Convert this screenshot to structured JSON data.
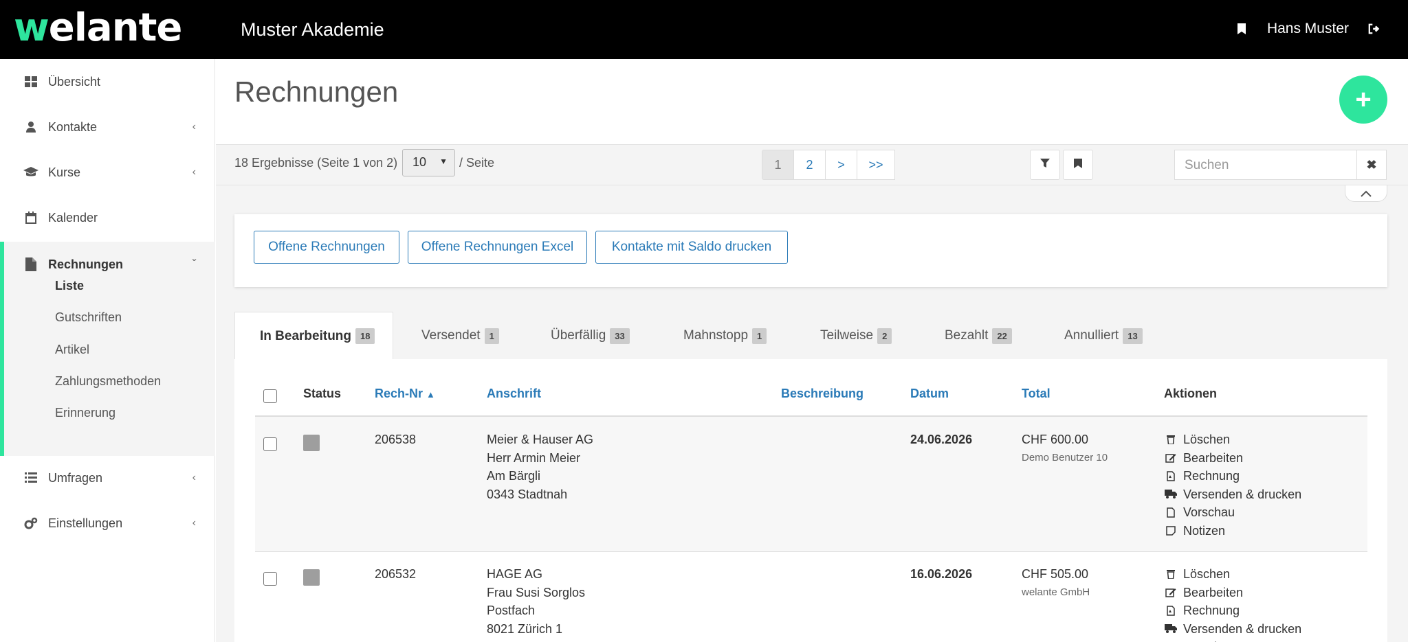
{
  "app": {
    "logo_w": "w",
    "logo_rest": "elante",
    "org_name": "Muster Akademie",
    "user_name": "Hans Muster",
    "brand_color": "#2ee59d"
  },
  "sidebar": {
    "items": [
      {
        "label": "Übersicht",
        "icon": "dashboard-icon"
      },
      {
        "label": "Kontakte",
        "icon": "user-icon"
      },
      {
        "label": "Kurse",
        "icon": "graduation-cap-icon"
      },
      {
        "label": "Kalender",
        "icon": "calendar-icon"
      },
      {
        "label": "Rechnungen",
        "icon": "file-icon"
      },
      {
        "label": "Umfragen",
        "icon": "list-icon"
      },
      {
        "label": "Einstellungen",
        "icon": "gears-icon"
      }
    ],
    "sub_items": [
      "Liste",
      "Gutschriften",
      "Artikel",
      "Zahlungsmethoden",
      "Erinnerung"
    ]
  },
  "page": {
    "title": "Rechnungen",
    "add_label": "+"
  },
  "toolbar": {
    "results_text": "18 Ergebnisse (Seite 1 von 2)",
    "per_page_value": "10",
    "per_page_label": "/ Seite",
    "pages": [
      "1",
      "2",
      ">",
      ">>"
    ],
    "search_placeholder": "Suchen",
    "clear_label": "✖"
  },
  "quick_actions": [
    "Offene Rechnungen",
    "Offene Rechnungen Excel",
    "Kontakte mit Saldo drucken"
  ],
  "tabs": [
    {
      "label": "In Bearbeitung",
      "count": "18"
    },
    {
      "label": "Versendet",
      "count": "1"
    },
    {
      "label": "Überfällig",
      "count": "33"
    },
    {
      "label": "Mahnstopp",
      "count": "1"
    },
    {
      "label": "Teilweise",
      "count": "2"
    },
    {
      "label": "Bezahlt",
      "count": "22"
    },
    {
      "label": "Annulliert",
      "count": "13"
    }
  ],
  "table": {
    "columns": [
      "Status",
      "Rech-Nr",
      "Anschrift",
      "Beschreibung",
      "Datum",
      "Total",
      "Aktionen"
    ],
    "action_labels": [
      "Löschen",
      "Bearbeiten",
      "Rechnung",
      "Versenden & drucken",
      "Vorschau",
      "Notizen"
    ],
    "rows": [
      {
        "number": "206538",
        "address": [
          "Meier & Hauser AG",
          "Herr Armin Meier",
          "Am Bärgli",
          "0343 Stadtnah"
        ],
        "date": "24.06.2026",
        "total": "CHF 600.00",
        "creator": "Demo Benutzer 10"
      },
      {
        "number": "206532",
        "address": [
          "HAGE AG",
          "Frau Susi Sorglos",
          "Postfach",
          "8021 Zürich 1"
        ],
        "date": "16.06.2026",
        "total": "CHF 505.00",
        "creator": "welante GmbH"
      }
    ]
  }
}
